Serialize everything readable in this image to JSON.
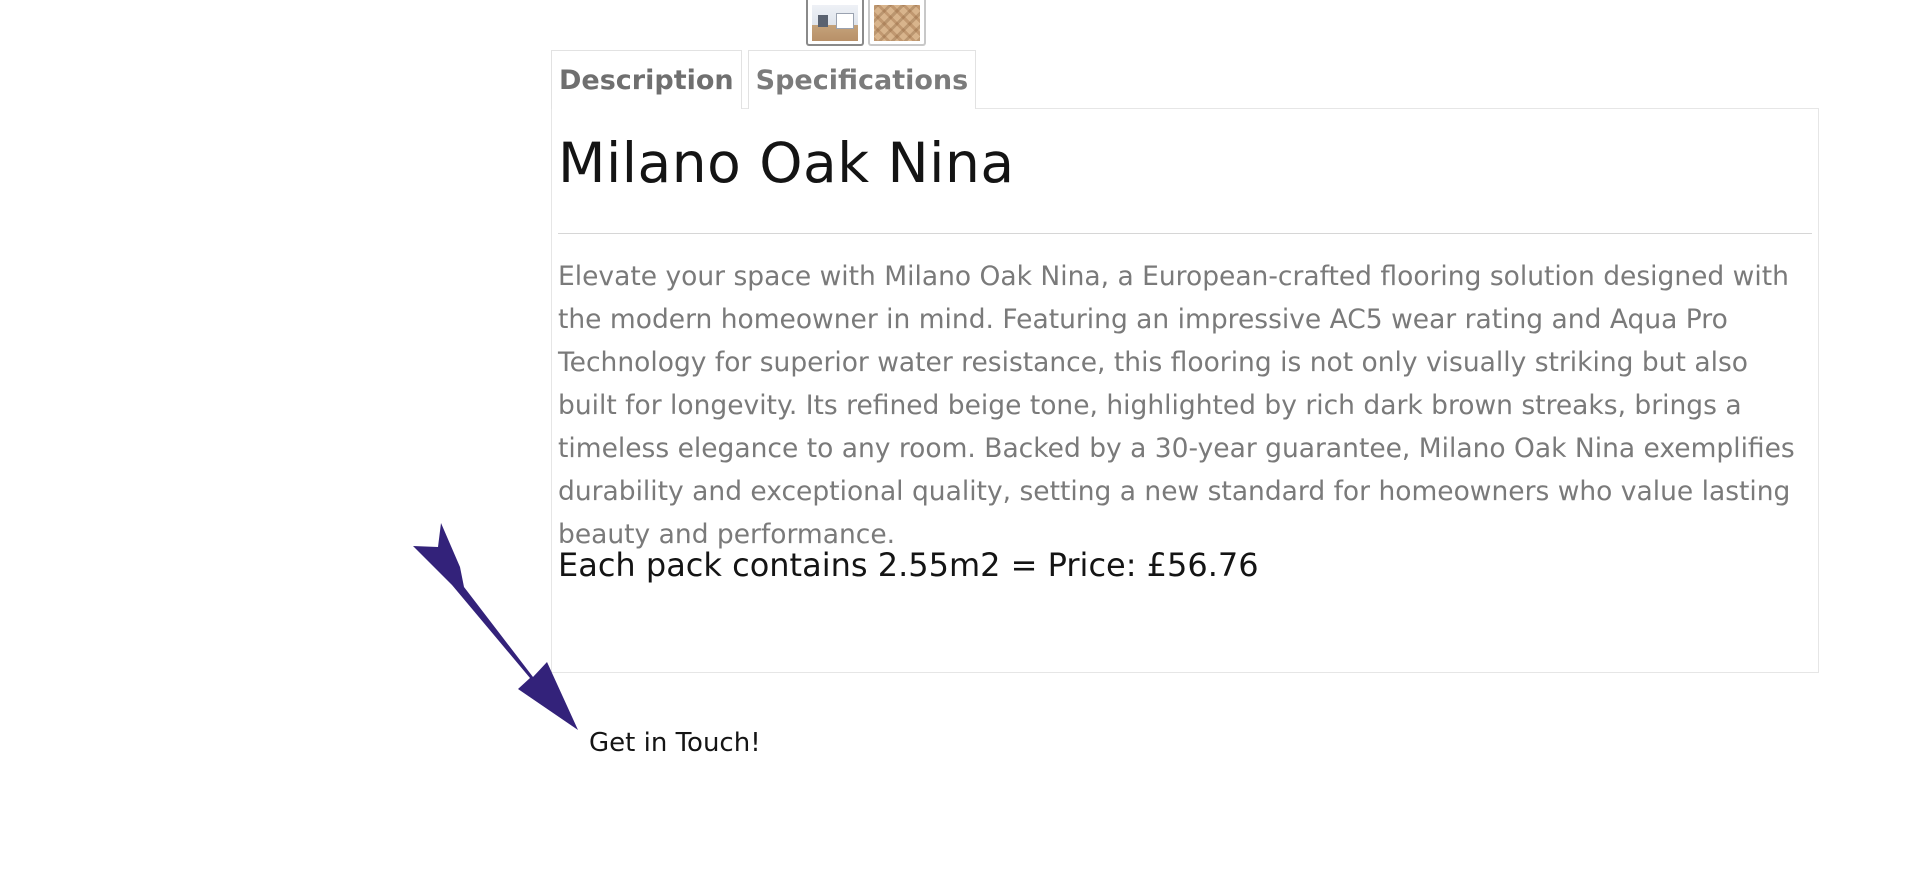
{
  "gallery": {
    "thumbnails": [
      {
        "name": "room-photo",
        "active": true
      },
      {
        "name": "wood-texture",
        "active": false
      }
    ]
  },
  "tabs": [
    {
      "label": "Description",
      "active": true
    },
    {
      "label": "Specifications",
      "active": false
    }
  ],
  "product": {
    "title": "Milano Oak Nina",
    "description": "Elevate your space with Milano Oak Nina, a European-crafted flooring solution designed with the modern homeowner in mind. Featuring an impressive AC5 wear rating and Aqua Pro Technology for superior water resistance, this flooring is not only visually striking but also built for longevity. Its refined beige tone, highlighted by rich dark brown streaks, brings a timeless elegance to any room. Backed by a 30-year guarantee, Milano Oak Nina exemplifies durability and exceptional quality, setting a new standard for homeowners who value lasting beauty and performance.",
    "price_line": "Each pack contains 2.55m2 = Price: £56.76"
  },
  "cta": {
    "label": "Get in Touch!"
  },
  "colors": {
    "arrow": "#33227a",
    "title_text": "#141414",
    "body_text": "#7a7a7a"
  },
  "icons": {
    "arrow": "arrow-down-right-icon"
  }
}
